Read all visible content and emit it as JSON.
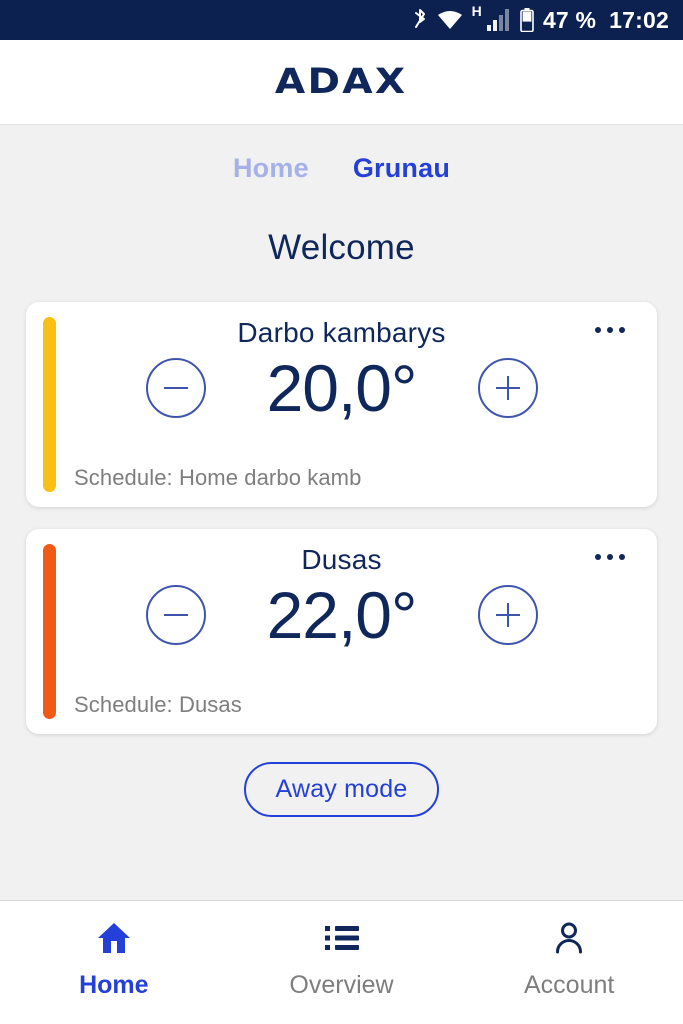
{
  "status_bar": {
    "bluetooth_icon": "bluetooth-icon",
    "wifi_icon": "wifi-icon",
    "network_type": "H",
    "signal_icon": "cellular-signal-icon",
    "battery_icon": "battery-icon",
    "battery_label": "47 %",
    "time": "17:02",
    "background_color": "#0d2150"
  },
  "header": {
    "logo_text": "ADAX"
  },
  "tabs": [
    {
      "label": "Home",
      "active": false
    },
    {
      "label": "Grunau",
      "active": true
    }
  ],
  "page_title": "Welcome",
  "rooms": [
    {
      "name": "Darbo kambarys",
      "temperature": "20,0°",
      "schedule": "Schedule: Home darbo kamb",
      "status_color": "#f9c013",
      "decrease_label": "−",
      "increase_label": "+",
      "menu_label": "•••"
    },
    {
      "name": "Dusas",
      "temperature": "22,0°",
      "schedule": "Schedule: Dusas",
      "status_color": "#f15a15",
      "decrease_label": "−",
      "increase_label": "+",
      "menu_label": "•••"
    }
  ],
  "away_button": {
    "label": "Away mode",
    "accent_color": "#2540d8"
  },
  "bottom_nav": [
    {
      "label": "Home",
      "icon": "home-icon",
      "active": true
    },
    {
      "label": "Overview",
      "icon": "list-icon",
      "active": false
    },
    {
      "label": "Account",
      "icon": "person-icon",
      "active": false
    }
  ],
  "colors": {
    "navy": "#10275c",
    "accent_blue": "#2540d8",
    "page_background": "#f1f1f1",
    "muted_text": "#7e7e7e"
  }
}
